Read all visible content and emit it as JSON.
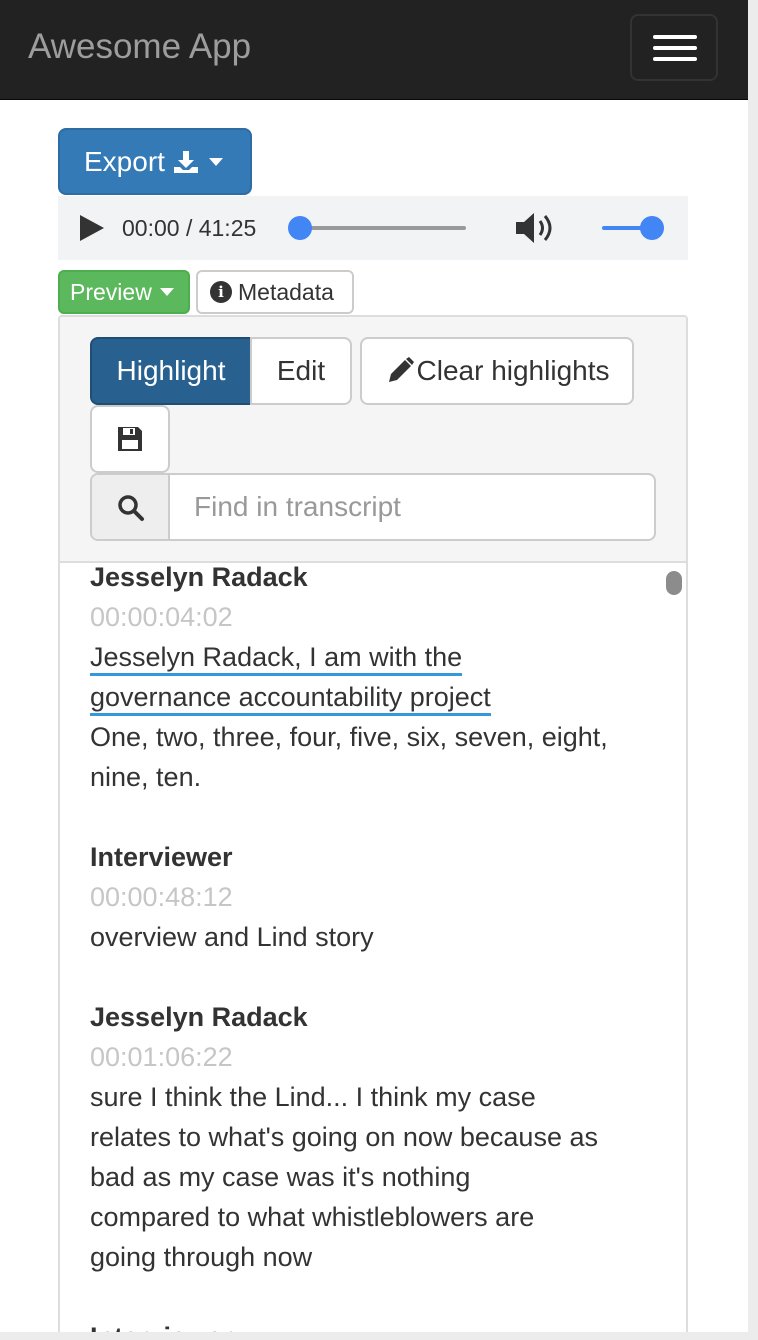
{
  "navbar": {
    "brand": "Awesome App"
  },
  "toolbar": {
    "export_label": "Export"
  },
  "player": {
    "time": "00:00 / 41:25",
    "progress": 0,
    "volume": 1.0
  },
  "tabs": {
    "preview_label": "Preview",
    "metadata_label": "Metadata"
  },
  "editor": {
    "highlight_label": "Highlight",
    "edit_label": "Edit",
    "clear_label": "Clear highlights",
    "search_placeholder": "Find in transcript"
  },
  "transcript": [
    {
      "speaker": "Jesselyn Radack",
      "timestamp": "00:00:04:02",
      "highlighted": [
        "Jesselyn Radack, I am with the",
        "governance accountability project"
      ],
      "text": [
        "One, two, three, four, five, six, seven, eight,",
        "nine, ten."
      ]
    },
    {
      "speaker": "Interviewer",
      "timestamp": "00:00:48:12",
      "highlighted": [],
      "text": [
        "overview and Lind story"
      ]
    },
    {
      "speaker": "Jesselyn Radack",
      "timestamp": "00:01:06:22",
      "highlighted": [],
      "text": [
        "sure I think the Lind... I think my case",
        "relates to what's going on now because as",
        "bad as my case was it's nothing",
        "compared to what whistleblowers are",
        "going through now"
      ]
    },
    {
      "speaker": "Interviewer",
      "timestamp": "",
      "highlighted": [],
      "text": []
    }
  ]
}
